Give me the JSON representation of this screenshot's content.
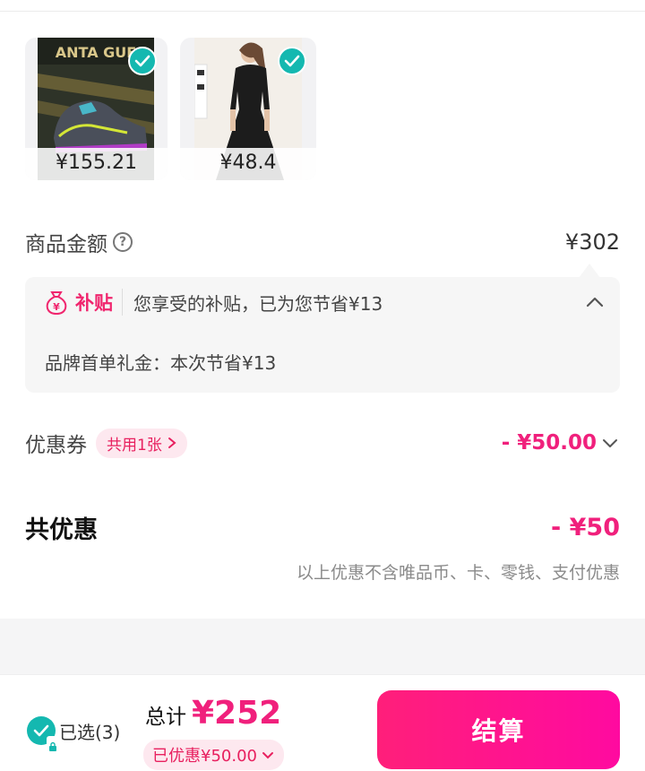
{
  "products": [
    {
      "price": "¥155.21",
      "image": "black-sneaker",
      "selected": true
    },
    {
      "price": "¥48.4",
      "image": "black-dress",
      "selected": true
    }
  ],
  "amount": {
    "label": "商品金额",
    "value": "¥302"
  },
  "subsidy": {
    "tag": "补贴",
    "summary": "您享受的补贴，已为您节省¥13",
    "detail": "品牌首单礼金：本次节省¥13"
  },
  "coupon": {
    "label": "优惠券",
    "badge": "共用1张",
    "value": "- ¥50.00"
  },
  "discount": {
    "label": "共优惠",
    "value": "- ¥50",
    "note": "以上优惠不含唯品币、卡、零钱、支付优惠"
  },
  "footer": {
    "selected_label": "已选(3)",
    "total_label": "总计",
    "total_value": "¥252",
    "saved_label": "已优惠¥50.00",
    "checkout_label": "结算"
  },
  "colors": {
    "accent": "#f0207c",
    "check": "#14b8b0",
    "badge_bg": "#fde8ef"
  }
}
